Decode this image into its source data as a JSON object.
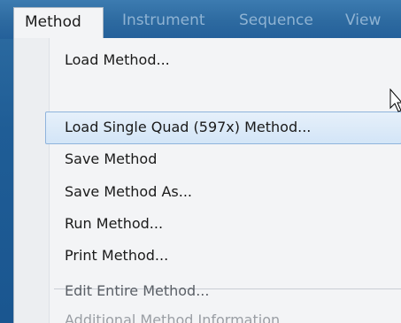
{
  "menubar": {
    "items": [
      {
        "label": "Method",
        "active": true
      },
      {
        "label": "Instrument",
        "active": false
      },
      {
        "label": "Sequence",
        "active": false
      },
      {
        "label": "View",
        "active": false
      }
    ]
  },
  "method_menu": {
    "items": [
      {
        "label": "Load Method...",
        "enabled": true
      },
      {
        "label": "Load Single Quad (597x) Method...",
        "enabled": true,
        "highlighted": true
      },
      {
        "label": "Save Method",
        "enabled": true
      },
      {
        "label": "Save Method As...",
        "enabled": true
      },
      {
        "label": "Run Method...",
        "enabled": true
      },
      {
        "label": "Print Method...",
        "enabled": true
      },
      {
        "label": "Edit Entire Method...",
        "enabled": true
      },
      {
        "label": "Additional Method Information...",
        "enabled": false
      }
    ]
  },
  "colors": {
    "highlight_border": "#8fb4dc",
    "menu_background": "#f3f4f6",
    "disabled_text": "#9a9ea4",
    "window_background": "#1f5d96"
  },
  "icons": {
    "cursor": "arrow-cursor-icon"
  }
}
